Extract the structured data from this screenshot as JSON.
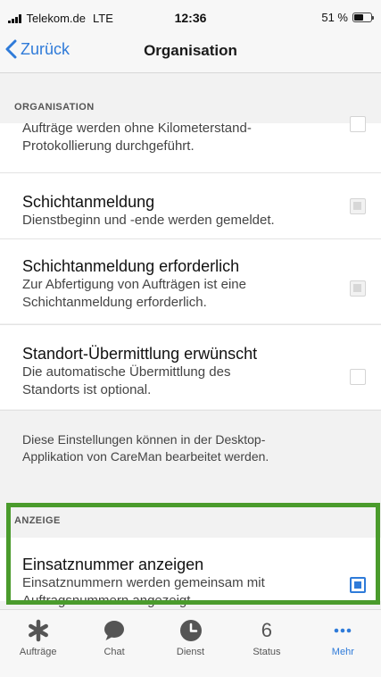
{
  "status_bar": {
    "carrier": "Telekom.de",
    "network": "LTE",
    "time": "12:36",
    "battery_text": "51 %",
    "battery_level": 0.51
  },
  "nav": {
    "back_label": "Zurück",
    "title": "Organisation"
  },
  "sections": {
    "organisation": {
      "header": "ORGANISATION",
      "partial_row_text_1": "Aufträge werden ohne Kilometerstand-",
      "partial_row_text_2": "Protokollierung durchgeführt.",
      "rows": [
        {
          "title": "Schichtanmeldung",
          "subtitle": "Dienstbeginn und -ende werden gemeldet.",
          "checked": true,
          "enabled": false
        },
        {
          "title": "Schichtanmeldung erforderlich",
          "subtitle_1": "Zur Abfertigung von Aufträgen ist eine",
          "subtitle_2": "Schichtanmeldung erforderlich.",
          "checked": true,
          "enabled": false
        },
        {
          "title": "Standort-Übermittlung erwünscht",
          "subtitle_1": "Die automatische Übermittlung des",
          "subtitle_2": "Standorts ist optional.",
          "checked": false,
          "enabled": false
        }
      ],
      "footer_1": "Diese Einstellungen können in der Desktop-",
      "footer_2": "Applikation von CareMan bearbeitet werden."
    },
    "anzeige": {
      "header": "ANZEIGE",
      "rows": [
        {
          "title": "Einsatznummer anzeigen",
          "subtitle_1": "Einsatznummern werden gemeinsam mit",
          "subtitle_2": "Auftragsnummern angezeigt",
          "checked": true,
          "enabled": true
        }
      ]
    }
  },
  "tabs": [
    {
      "label": "Aufträge",
      "icon": "asterisk-icon"
    },
    {
      "label": "Chat",
      "icon": "chat-bubble-icon"
    },
    {
      "label": "Dienst",
      "icon": "clock-icon"
    },
    {
      "label": "Status",
      "icon": "number-icon",
      "value": "6"
    },
    {
      "label": "Mehr",
      "icon": "more-dots-icon",
      "active": true
    }
  ],
  "colors": {
    "accent": "#2f7bd9",
    "highlight_border": "#4a9b2c",
    "background": "#f2f2f2"
  }
}
